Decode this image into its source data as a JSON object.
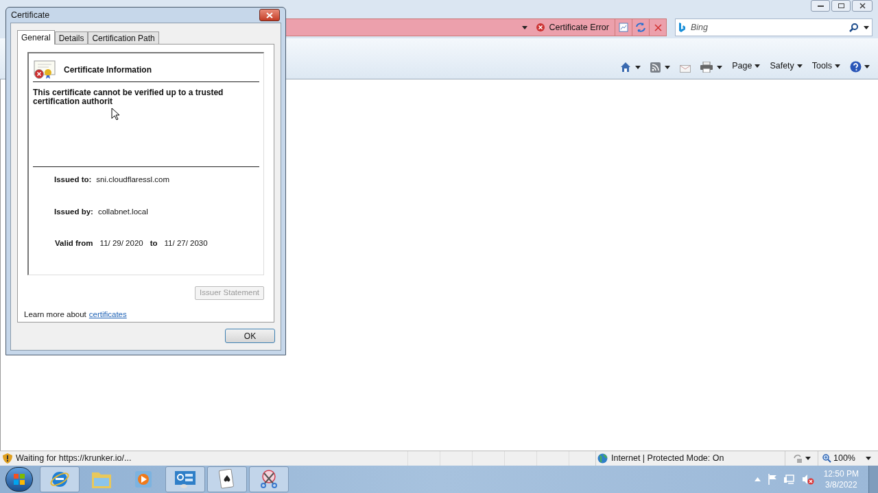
{
  "browser": {
    "security_label": "Certificate Error",
    "search": {
      "placeholder": "Bing"
    },
    "command_bar": [
      {
        "label": "Page"
      },
      {
        "label": "Safety"
      },
      {
        "label": "Tools"
      }
    ],
    "status_bar": {
      "message": "Waiting for https://krunker.io/...",
      "zone": "Internet | Protected Mode: On",
      "zoom": "100%"
    }
  },
  "dialog": {
    "title": "Certificate",
    "tabs": [
      {
        "label": "General",
        "selected": true
      },
      {
        "label": "Details",
        "selected": false
      },
      {
        "label": "Certification Path",
        "selected": false
      }
    ],
    "heading": "Certificate Information",
    "message": "This certificate cannot be verified up to a trusted certification authorit",
    "issued_to": {
      "label": "Issued to:",
      "value": "sni.cloudflaressl.com"
    },
    "issued_by": {
      "label": "Issued by:",
      "value": "collabnet.local"
    },
    "validity": {
      "label": "Valid from",
      "from": "11/ 29/ 2020",
      "to_label": "to",
      "to": "11/ 27/ 2030"
    },
    "issuer_button": {
      "label": "Issuer Statement",
      "disabled": true
    },
    "learn_more": {
      "text": "Learn more about",
      "link": "certificates"
    },
    "ok_button": "OK"
  },
  "taskbar": {
    "items": [
      {
        "kind": "browser",
        "running": true
      },
      {
        "kind": "folder",
        "running": false
      },
      {
        "kind": "media",
        "running": false
      },
      {
        "kind": "panel",
        "running": true
      },
      {
        "kind": "cards",
        "running": true
      },
      {
        "kind": "snip",
        "running": true
      }
    ],
    "clock": {
      "time": "12:50 PM",
      "date": "3/8/2022"
    }
  }
}
